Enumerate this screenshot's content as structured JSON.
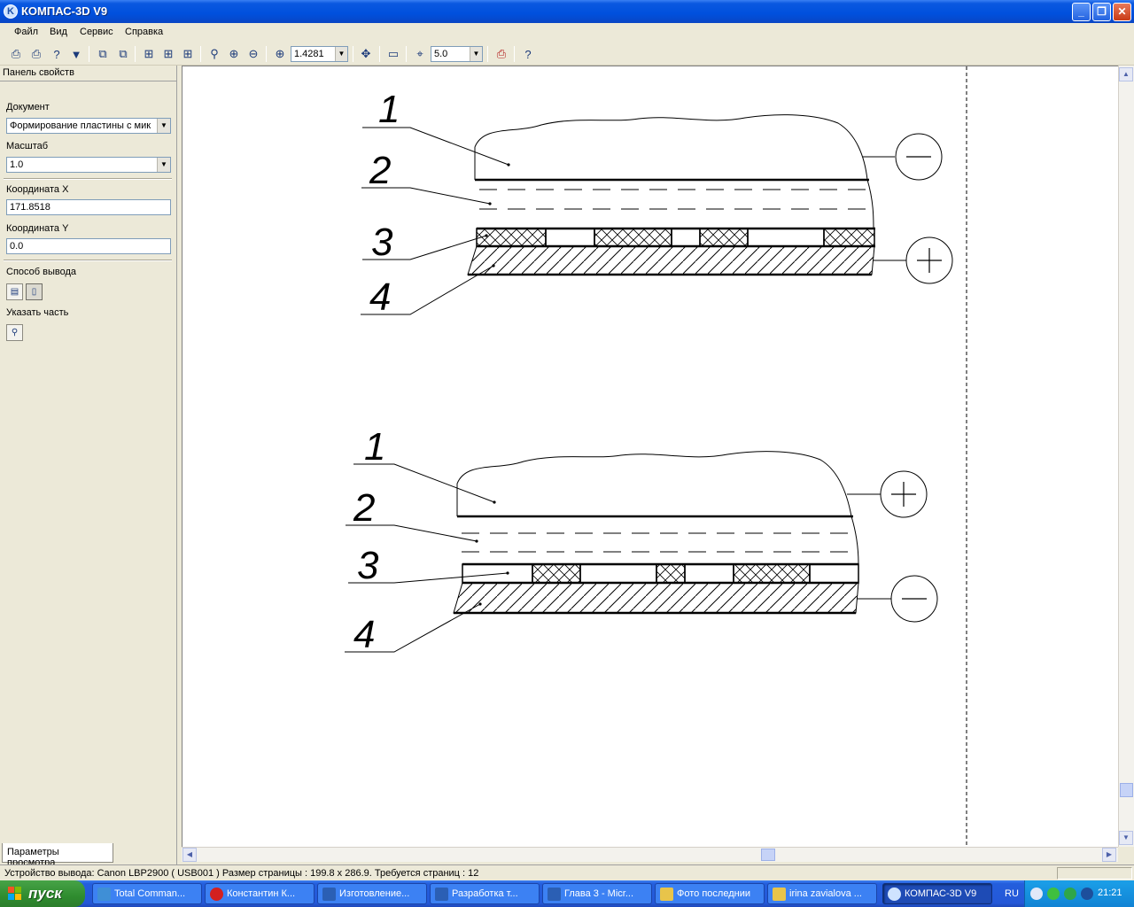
{
  "window": {
    "title": "КОМПАС-3D V9",
    "icon": "kompas-logo-icon"
  },
  "menu": [
    "Файл",
    "Вид",
    "Сервис",
    "Справка"
  ],
  "toolbar": {
    "zoom_value": "1.4281",
    "step_value": "5.0",
    "icons": [
      "print-icon",
      "print-setup-icon",
      "help-doc-icon",
      "filter-icon",
      "copy-page-icon",
      "paste-page-icon",
      "layout-1-icon",
      "layout-2-icon",
      "layout-3-icon",
      "zoom-window-icon",
      "zoom-in-icon",
      "zoom-out-icon",
      "zoom-scale-icon",
      "pan-icon",
      "page-view-icon",
      "snap-icon",
      "print-preview-icon",
      "context-help-icon"
    ]
  },
  "panel": {
    "header": "Панель свойств",
    "document_label": "Документ",
    "document_value": "Формирование пластины с мик",
    "scale_label": "Масштаб",
    "scale_value": "1.0",
    "coord_x_label": "Координата X",
    "coord_x_value": "171.8518",
    "coord_y_label": "Координата Y",
    "coord_y_value": "0.0",
    "output_label": "Способ вывода",
    "part_label": "Указать часть",
    "tab_label": "Параметры просмотра"
  },
  "drawing": {
    "layer_labels_top": [
      "1",
      "2",
      "3",
      "4"
    ],
    "layer_labels_bottom": [
      "1",
      "2",
      "3",
      "4"
    ],
    "polarity_top": [
      "minus",
      "plus"
    ],
    "polarity_bottom": [
      "plus",
      "minus"
    ]
  },
  "status": {
    "text": "Устройство вывода: Canon LBP2900 ( USB001 )  Размер страницы : 199.8 x 286.9.  Требуется страниц : 12"
  },
  "taskbar": {
    "start_label": "пуск",
    "tasks": [
      {
        "label": "Total Comman...",
        "icon_color": "#3f8fd6"
      },
      {
        "label": "Константин К...",
        "icon_color": "#d32020"
      },
      {
        "label": "Изготовление...",
        "icon_color": "#2b5fb4"
      },
      {
        "label": "Разработка т...",
        "icon_color": "#2b5fb4"
      },
      {
        "label": "Глава 3 - Micr...",
        "icon_color": "#2b5fb4"
      },
      {
        "label": "Фото последнии",
        "icon_color": "#e8c44a"
      },
      {
        "label": "irina zavialova ...",
        "icon_color": "#e8c44a"
      },
      {
        "label": "КОМПАС-3D V9",
        "icon_color": "#cfe3ff"
      }
    ],
    "lang": "RU",
    "clock": "21:21"
  }
}
